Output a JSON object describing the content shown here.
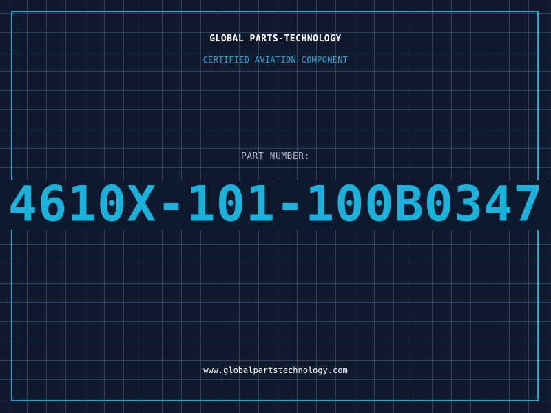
{
  "header": {
    "company": "GLOBAL PARTS-TECHNOLOGY",
    "subtitle": "CERTIFIED AVIATION COMPONENT"
  },
  "part": {
    "label": "PART NUMBER:",
    "number": "4610X-101-100B0347"
  },
  "footer": {
    "website": "www.globalpartstechnology.com"
  },
  "colors": {
    "background": "#0f1a2e",
    "grid": "#286e8c",
    "accent": "#1ab2da",
    "text": "#ffffff",
    "muted": "#a9b6c6"
  }
}
